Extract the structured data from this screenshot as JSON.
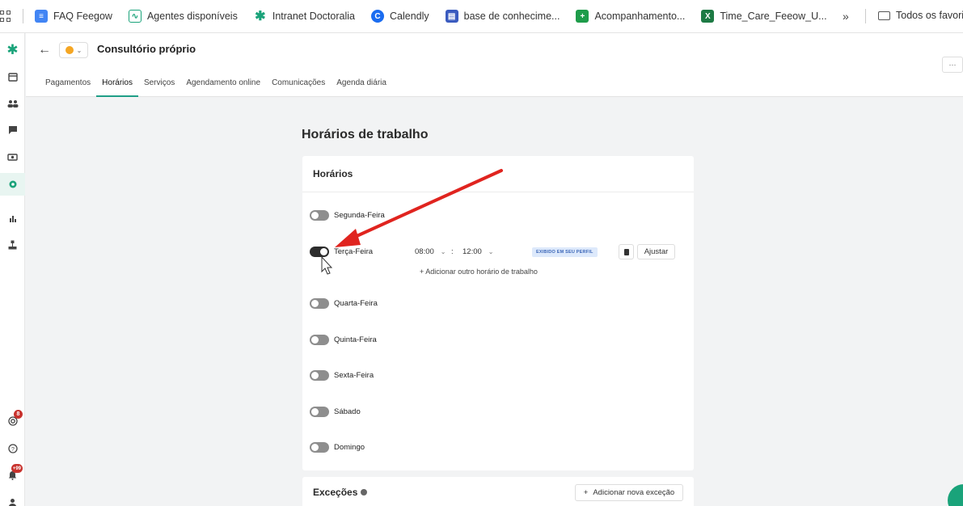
{
  "bookmarks": {
    "items": [
      {
        "label": "FAQ Feegow",
        "icon": "doc-icon",
        "color": "#4285f4"
      },
      {
        "label": "Agentes disponíveis",
        "icon": "chart-icon",
        "color": "#1aa37a"
      },
      {
        "label": "Intranet Doctoralia",
        "icon": "asterisk-icon",
        "color": "#1aa37a"
      },
      {
        "label": "Calendly",
        "icon": "calendly-icon",
        "color": "#1a6cf0"
      },
      {
        "label": "base de conhecime...",
        "icon": "table-icon",
        "color": "#3a5bbf"
      },
      {
        "label": "Acompanhamento...",
        "icon": "plus-sheet-icon",
        "color": "#1e9c4a"
      },
      {
        "label": "Time_Care_Feeow_U...",
        "icon": "excel-icon",
        "color": "#1d7a44"
      }
    ],
    "overflow": "»",
    "folder_label": "Todos os favoritos"
  },
  "rail": {
    "items": [
      {
        "name": "asterisk-logo-icon",
        "glyph": "✱"
      },
      {
        "name": "calendar-icon",
        "glyph": "▦"
      },
      {
        "name": "people-icon",
        "glyph": "👥"
      },
      {
        "name": "chat-icon",
        "glyph": "▬"
      },
      {
        "name": "money-icon",
        "glyph": "▣"
      },
      {
        "name": "gear-icon",
        "glyph": "⚙"
      },
      {
        "name": "bar-chart-icon",
        "glyph": "▮"
      },
      {
        "name": "org-chart-icon",
        "glyph": "⊥"
      }
    ],
    "bottom": [
      {
        "name": "target-icon",
        "glyph": "◎",
        "badge": "8"
      },
      {
        "name": "help-icon",
        "glyph": "?",
        "badge": ""
      },
      {
        "name": "bell-icon",
        "glyph": "●",
        "badge": "+99"
      },
      {
        "name": "user-icon",
        "glyph": "●",
        "badge": ""
      }
    ]
  },
  "header": {
    "title": "Consultório próprio",
    "status_color": "#f5a623",
    "more": "···",
    "tabs": [
      "Pagamentos",
      "Horários",
      "Serviços",
      "Agendamento online",
      "Comunicações",
      "Agenda diária"
    ],
    "active_tab": "Horários"
  },
  "main": {
    "section_title": "Horários de trabalho",
    "card_title": "Horários",
    "days": [
      {
        "label": "Segunda-Feira",
        "on": false
      },
      {
        "label": "Terça-Feira",
        "on": true
      },
      {
        "label": "Quarta-Feira",
        "on": false
      },
      {
        "label": "Quinta-Feira",
        "on": false
      },
      {
        "label": "Sexta-Feira",
        "on": false
      },
      {
        "label": "Sábado",
        "on": false
      },
      {
        "label": "Domingo",
        "on": false
      }
    ],
    "tuesday": {
      "start": "08:00",
      "separator": ":",
      "end": "12:00",
      "profile_tag": "EXIBIDO EM SEU PERFIL",
      "adjust": "Ajustar",
      "add_link": "+ Adicionar outro horário de trabalho"
    },
    "exceptions_title": "Exceções",
    "add_exception": "Adicionar nova exceção",
    "add_exception_plus": "+"
  },
  "colors": {
    "accent": "#1aa37a",
    "arrow": "#e0241f",
    "tab_underline": "#1f9e87"
  }
}
